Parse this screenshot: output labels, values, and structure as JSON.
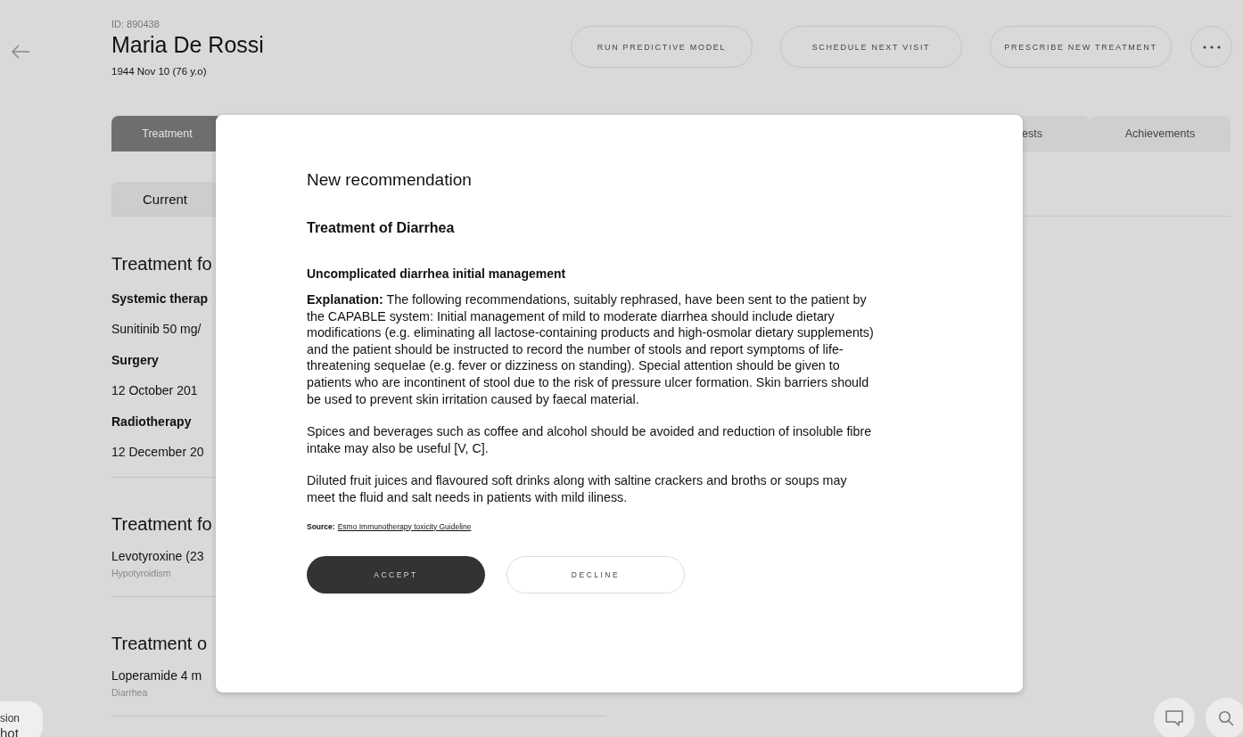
{
  "header": {
    "patient_id": "ID: 890438",
    "name": "Maria De Rossi",
    "birth": "1944 Nov 10 (76 y.o)"
  },
  "actions": [
    "RUN PREDICTIVE MODEL",
    "SCHEDULE NEXT VISIT",
    "PRESCRIBE NEW TREATMENT"
  ],
  "tabs": [
    {
      "label": "Treatment",
      "selected": true
    },
    {
      "label": "ests",
      "selected": false
    },
    {
      "label": "Achievements",
      "selected": false
    }
  ],
  "subtabs": [
    {
      "label": "Current",
      "selected": true
    }
  ],
  "sections": [
    {
      "title": "Treatment fo",
      "items": [
        {
          "kind": "heading",
          "text": "Systemic therap"
        },
        {
          "kind": "value",
          "text": "Sunitinib 50 mg/"
        },
        {
          "kind": "heading",
          "text": "Surgery"
        },
        {
          "kind": "value",
          "text": "12 October 201"
        },
        {
          "kind": "heading",
          "text": "Radiotherapy"
        },
        {
          "kind": "value",
          "text": "12 December 20"
        }
      ]
    },
    {
      "title": "Treatment fo",
      "items": [
        {
          "kind": "value",
          "text": "Levotyroxine (23"
        },
        {
          "kind": "note",
          "text": "Hypotyroidism"
        }
      ]
    },
    {
      "title": "Treatment o",
      "items": [
        {
          "kind": "value",
          "text": "Loperamide 4 m"
        },
        {
          "kind": "note",
          "text": "Diarrhea"
        }
      ]
    }
  ],
  "modal": {
    "title": "New recommendation",
    "subject": "Treatment of Diarrhea",
    "heading": "Uncomplicated diarrhea initial management",
    "paragraphs": [
      "**Explanation:** The following recommendations, suitably rephrased, have been sent to the patient by the CAPABLE system: Initial management of mild to moderate diarrhea should include dietary modifications (e.g. eliminating all lactose-containing products and high-osmolar dietary supplements) and the patient should be instructed to record the number of stools and report symptoms of life-threatening sequelae (e.g. fever or dizziness on standing). Special attention should be given to patients who are incontinent of stool due to the risk of pressure ulcer formation. Skin barriers should be used to prevent skin irritation caused by faecal material.",
      "Spices and beverages such as coffee and alcohol should be avoided and reduction of insoluble fibre intake may also be useful [V, C].",
      "Diluted fruit juices and flavoured soft drinks along with saltine crackers and broths or soups may meet the fluid and salt needs in patients with mild iliness."
    ],
    "source_label": "Source:",
    "source_link": "Esmo Immunotherapy toxicity Guideline",
    "buttons": [
      {
        "label": "ACCEPT",
        "kind": "primary"
      },
      {
        "label": "DECLINE",
        "kind": "secondary"
      }
    ]
  },
  "chat_widget": [
    "sion",
    "hot"
  ]
}
